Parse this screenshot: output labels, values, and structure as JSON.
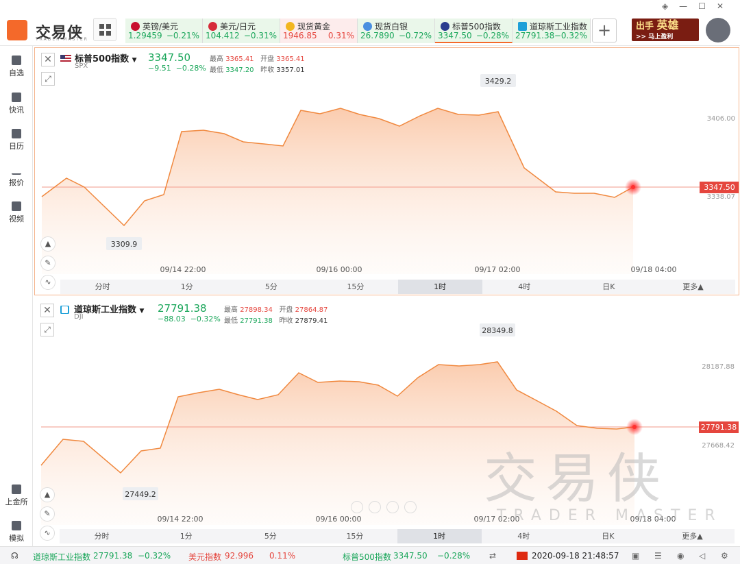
{
  "app": {
    "logo": "交易侠",
    "logo_sub": "TRADER MASTER",
    "promo_line1": "出手",
    "promo_sub": "马上盈利",
    "promo_big": "英雄"
  },
  "tickers": [
    {
      "name": "英镑/美元",
      "price": "1.29459",
      "change": "−0.21%",
      "dir": "dn",
      "icon": "uk-flag-icon",
      "color": "#c8102e"
    },
    {
      "name": "美元/日元",
      "price": "104.412",
      "change": "−0.31%",
      "dir": "dn",
      "icon": "japan-flag-icon",
      "color": "#d62b3a"
    },
    {
      "name": "现货黄金",
      "price": "1946.85",
      "change": "0.31%",
      "dir": "up",
      "icon": "gold-icon",
      "color": "#f2b620"
    },
    {
      "name": "现货白银",
      "price": "26.7890",
      "change": "−0.72%",
      "dir": "dn",
      "icon": "silver-icon",
      "color": "#4a8fe0"
    },
    {
      "name": "标普500指数",
      "price": "3347.50",
      "change": "−0.28%",
      "dir": "dn",
      "icon": "us-flag-icon",
      "color": "#2a3d8f"
    },
    {
      "name": "道琼斯工业指数",
      "price": "27791.38",
      "change": "−0.32%",
      "dir": "dn",
      "icon": "dow-icon",
      "color": "#1ea0d8"
    }
  ],
  "sidebar": {
    "items": [
      {
        "label": "自选",
        "icon": "bookmark-icon"
      },
      {
        "label": "快讯",
        "icon": "news-icon"
      },
      {
        "label": "日历",
        "icon": "calendar-icon"
      },
      {
        "label": "报价",
        "icon": "quote-chart-icon"
      },
      {
        "label": "视频",
        "icon": "video-icon"
      }
    ],
    "bottom": [
      {
        "label": "上金所",
        "icon": "exchange-icon"
      },
      {
        "label": "模拟",
        "icon": "wallet-icon"
      }
    ]
  },
  "timeframes": [
    "分时",
    "1分",
    "5分",
    "15分",
    "1时",
    "4时",
    "日K",
    "更多▲"
  ],
  "active_tf": "1时",
  "panels": [
    {
      "name": "标普500指数",
      "code": "SPX",
      "price": "3347.50",
      "change": "−9.51",
      "pct": "−0.28%",
      "labels": {
        "high": "最高",
        "open": "开盘",
        "low": "最低",
        "prev": "昨收"
      },
      "high": "3365.41",
      "open": "3365.41",
      "low": "3347.20",
      "prev": "3357.01",
      "marker_hi": "3429.2",
      "marker_lo": "3309.9",
      "last_tag": "3347.50",
      "axis": [
        "3406.00",
        "3338.07"
      ],
      "xlabels": [
        "09/14 22:00",
        "09/16 00:00",
        "09/17 02:00",
        "09/18 04:00"
      ]
    },
    {
      "name": "道琼斯工业指数",
      "code": "DJI",
      "price": "27791.38",
      "change": "−88.03",
      "pct": "−0.32%",
      "labels": {
        "high": "最高",
        "open": "开盘",
        "low": "最低",
        "prev": "昨收"
      },
      "high": "27898.34",
      "open": "27864.87",
      "low": "27791.38",
      "prev": "27879.41",
      "marker_hi": "28349.8",
      "marker_lo": "27449.2",
      "last_tag": "27791.38",
      "axis": [
        "28187.88",
        "27668.42"
      ],
      "xlabels": [
        "09/14 22:00",
        "09/16 00:00",
        "09/17 02:00",
        "09/18 04:00"
      ]
    }
  ],
  "status": {
    "i1_name": "道琼斯工业指数",
    "i1_px": "27791.38",
    "i1_pc": "−0.32%",
    "i2_name": "美元指数",
    "i2_px": "92.996",
    "i2_pc": "0.11%",
    "i3_name": "标普500指数",
    "i3_px": "3347.50",
    "i3_pc": "−0.28%",
    "datetime": "2020-09-18 21:48:57"
  },
  "watermark": {
    "cn": "交易侠",
    "en": "TRADER MASTER"
  },
  "colors": {
    "up": "#e5463e",
    "down": "#1aa65a",
    "accent": "#f4692a"
  }
}
